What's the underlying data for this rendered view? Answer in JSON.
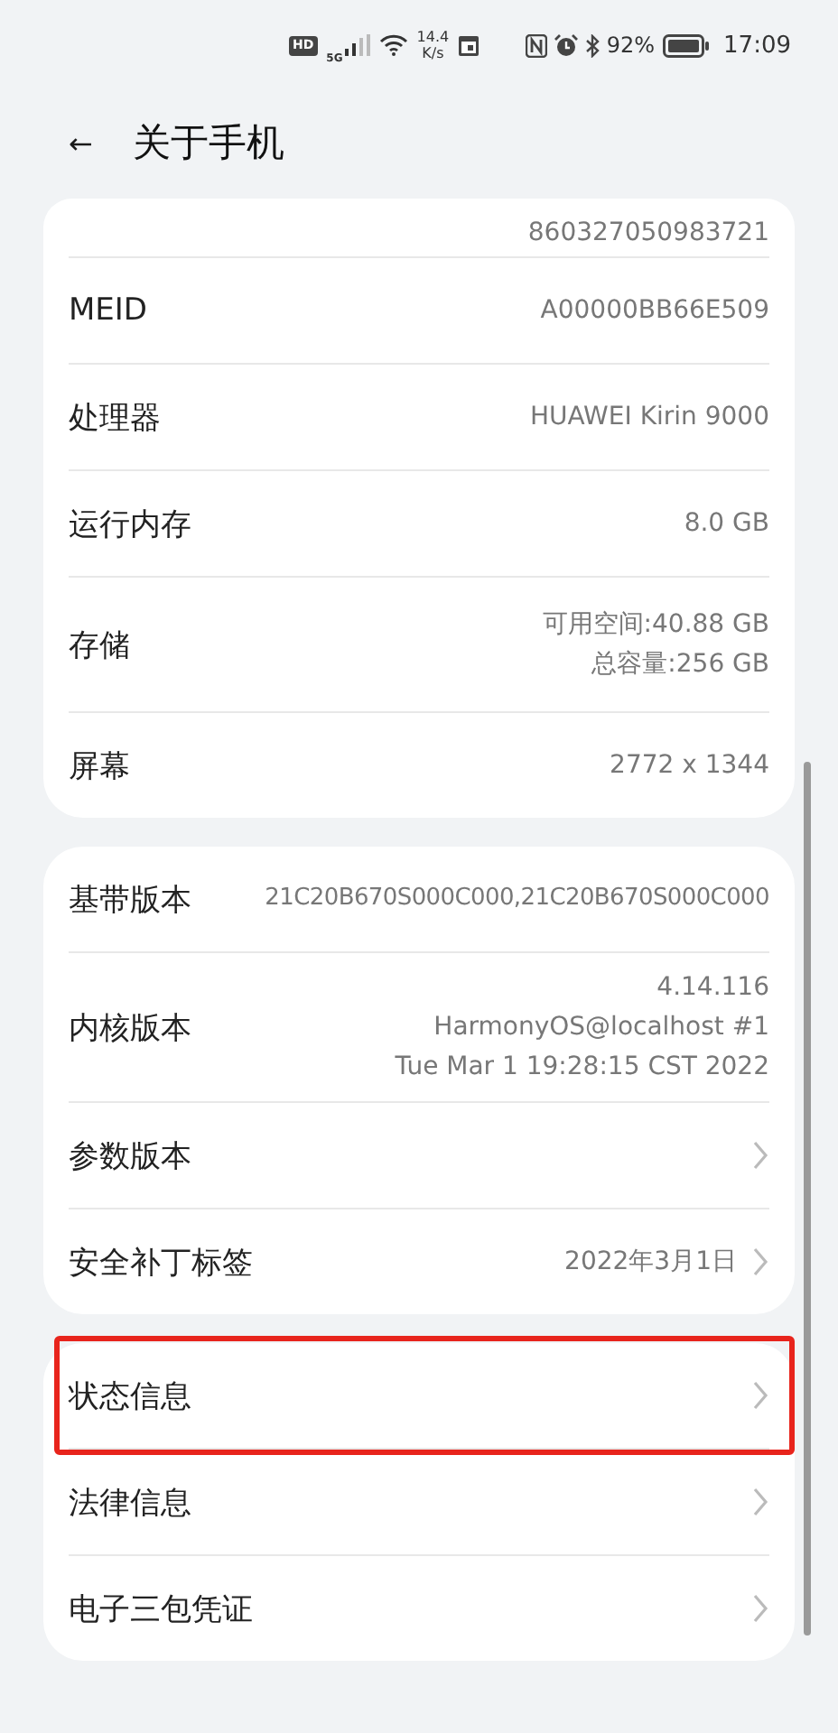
{
  "status_bar": {
    "hd_badge": "HD",
    "network": "5G",
    "speed_value": "14.4",
    "speed_unit": "K/s",
    "battery_percent": "92%",
    "time": "17:09"
  },
  "header": {
    "back_icon": "←",
    "title": "关于手机"
  },
  "groups": [
    {
      "rows": [
        {
          "label": "",
          "values": [
            "860327050983721"
          ],
          "chevron": false,
          "highlighted": false
        },
        {
          "label": "MEID",
          "values": [
            "A00000BB66E509"
          ],
          "chevron": false,
          "highlighted": false
        },
        {
          "label": "处理器",
          "values": [
            "HUAWEI Kirin 9000"
          ],
          "chevron": false,
          "highlighted": false
        },
        {
          "label": "运行内存",
          "values": [
            "8.0 GB"
          ],
          "chevron": false,
          "highlighted": false
        },
        {
          "label": "存储",
          "values": [
            "可用空间:40.88  GB",
            "总容量:256  GB"
          ],
          "chevron": false,
          "highlighted": false
        },
        {
          "label": "屏幕",
          "values": [
            "2772 x 1344"
          ],
          "chevron": false,
          "highlighted": false
        }
      ]
    },
    {
      "rows": [
        {
          "label": "基带版本",
          "values": [
            "21C20B670S000C000,21C20B670S000C000"
          ],
          "chevron": false,
          "highlighted": false
        },
        {
          "label": "内核版本",
          "values": [
            "4.14.116",
            "HarmonyOS@localhost #1",
            "Tue Mar 1 19:28:15 CST 2022"
          ],
          "chevron": false,
          "highlighted": false
        },
        {
          "label": "参数版本",
          "values": [],
          "chevron": true,
          "highlighted": false
        },
        {
          "label": "安全补丁标签",
          "values": [
            "2022年3月1日"
          ],
          "chevron": true,
          "highlighted": false
        }
      ]
    },
    {
      "rows": [
        {
          "label": "状态信息",
          "values": [],
          "chevron": true,
          "highlighted": true
        },
        {
          "label": "法律信息",
          "values": [],
          "chevron": true,
          "highlighted": false
        },
        {
          "label": "电子三包凭证",
          "values": [],
          "chevron": true,
          "highlighted": false
        }
      ]
    }
  ]
}
